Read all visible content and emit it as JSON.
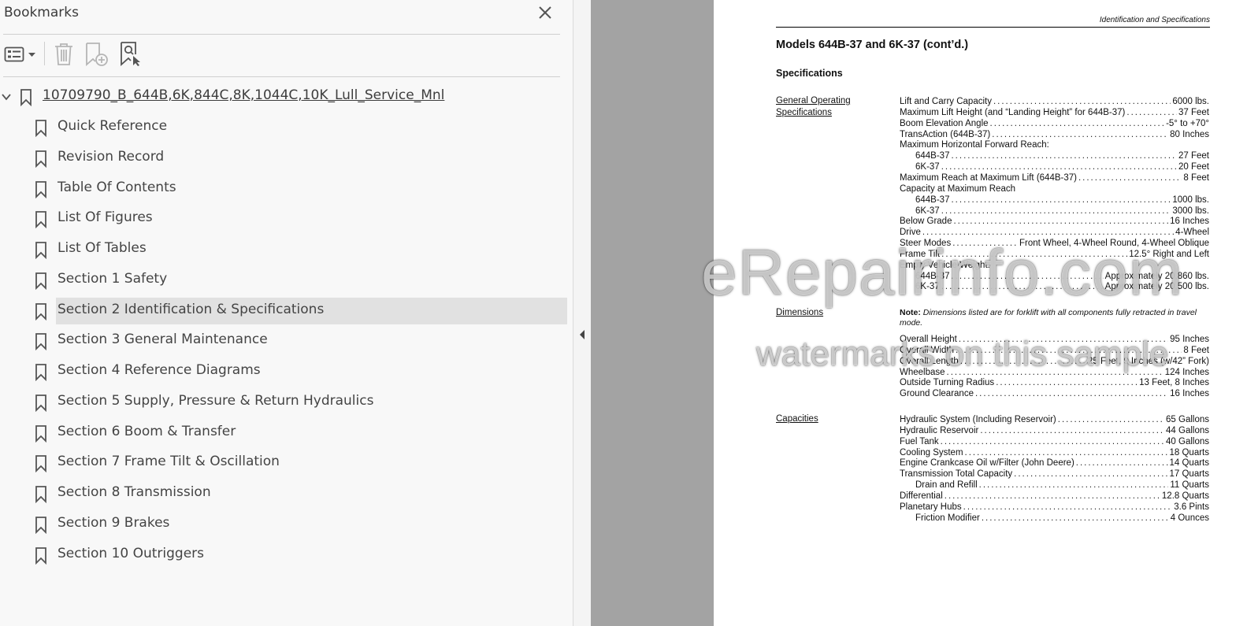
{
  "panel": {
    "title": "Bookmarks",
    "toolbar": {
      "options_icon": "list-options-icon",
      "delete_icon": "trash-icon",
      "new_bookmark_icon": "add-bookmark-icon",
      "find_bookmark_icon": "find-bookmark-icon"
    },
    "root_label": "10709790_B_644B,6K,844C,8K,1044C,10K_Lull_Service_Mnl",
    "items": [
      {
        "label": "Quick Reference"
      },
      {
        "label": "Revision Record"
      },
      {
        "label": "Table Of Contents"
      },
      {
        "label": "List Of Figures"
      },
      {
        "label": "List Of Tables"
      },
      {
        "label": "Section 1 Safety"
      },
      {
        "label": "Section 2 Identification & Specifications",
        "selected": true
      },
      {
        "label": "Section 3 General Maintenance"
      },
      {
        "label": "Section 4 Reference Diagrams"
      },
      {
        "label": "Section 5 Supply, Pressure & Return Hydraulics"
      },
      {
        "label": "Section 6 Boom & Transfer"
      },
      {
        "label": "Section 7 Frame Tilt & Oscillation"
      },
      {
        "label": "Section 8 Transmission"
      },
      {
        "label": "Section 9 Brakes"
      },
      {
        "label": "Section 10 Outriggers"
      }
    ]
  },
  "document": {
    "header": "Identification and Specifications",
    "title": "Models 644B-37 and 6K-37 (cont’d.)",
    "subtitle": "Specifications",
    "sections": {
      "general": "General Operating Specifications",
      "dimensions": "Dimensions",
      "capacities": "Capacities"
    },
    "general_specs": [
      {
        "k": "Lift and Carry Capacity",
        "v": "6000 lbs."
      },
      {
        "k": "Maximum Lift Height (and “Landing Height” for 644B-37)",
        "v": "37 Feet"
      },
      {
        "k": "Boom Elevation Angle",
        "v": "-5° to +70°"
      },
      {
        "k": "TransAction (644B-37)",
        "v": "80 Inches"
      },
      {
        "k": "Maximum Horizontal Forward Reach:",
        "v": ""
      },
      {
        "k": "644B-37",
        "v": "27 Feet",
        "indent": true
      },
      {
        "k": "6K-37",
        "v": "20 Feet",
        "indent": true
      },
      {
        "k": "Maximum Reach at Maximum Lift (644B-37)",
        "v": "8 Feet"
      },
      {
        "k": "Capacity at Maximum Reach",
        "v": ""
      },
      {
        "k": "644B-37",
        "v": "1000 lbs.",
        "indent": true
      },
      {
        "k": "6K-37",
        "v": "3000 lbs.",
        "indent": true
      },
      {
        "k": "Below Grade",
        "v": "16 Inches"
      },
      {
        "k": "Drive",
        "v": "4-Wheel"
      },
      {
        "k": "Steer Modes",
        "v": "Front Wheel, 4-Wheel Round, 4-Wheel Oblique"
      },
      {
        "k": "Frame Tilt",
        "v": "12.5° Right and Left"
      },
      {
        "k": "Empty Vehicle Weight:",
        "v": ""
      },
      {
        "k": "644B-37",
        "v": "Approximately 20,860 lbs.",
        "indent": true
      },
      {
        "k": "6K-37",
        "v": "Approximately 20,500 lbs.",
        "indent": true
      }
    ],
    "note_label": "Note:",
    "note_text": "Dimensions listed are for forklift with all components fully retracted in travel mode.",
    "dimension_specs": [
      {
        "k": "Overall Height",
        "v": "95 Inches"
      },
      {
        "k": "Overall Width",
        "v": "8 Feet"
      },
      {
        "k": "Overall Length",
        "v": "25 Feet, 9 Inches (w/42” Fork)"
      },
      {
        "k": "Wheelbase",
        "v": "124 Inches"
      },
      {
        "k": "Outside Turning Radius",
        "v": "13 Feet, 8 Inches"
      },
      {
        "k": "Ground Clearance",
        "v": "16 Inches"
      }
    ],
    "capacity_specs": [
      {
        "k": "Hydraulic System (Including Reservoir)",
        "v": "65 Gallons"
      },
      {
        "k": "Hydraulic Reservoir",
        "v": "44 Gallons"
      },
      {
        "k": "Fuel Tank",
        "v": "40 Gallons"
      },
      {
        "k": "Cooling System",
        "v": "18 Quarts"
      },
      {
        "k": "Engine Crankcase Oil w/Filter (John Deere)",
        "v": "14 Quarts"
      },
      {
        "k": "Transmission Total Capacity",
        "v": "17 Quarts"
      },
      {
        "k": "Drain and Refill",
        "v": "11 Quarts",
        "indent": true
      },
      {
        "k": "Differential",
        "v": "12.8 Quarts"
      },
      {
        "k": "Planetary Hubs",
        "v": "3.6 Pints"
      },
      {
        "k": "Friction Modifier",
        "v": "4 Ounces",
        "indent": true
      }
    ]
  },
  "watermark": {
    "line1": "eRepairinfo.com",
    "line2": "watermarks on this sample"
  }
}
